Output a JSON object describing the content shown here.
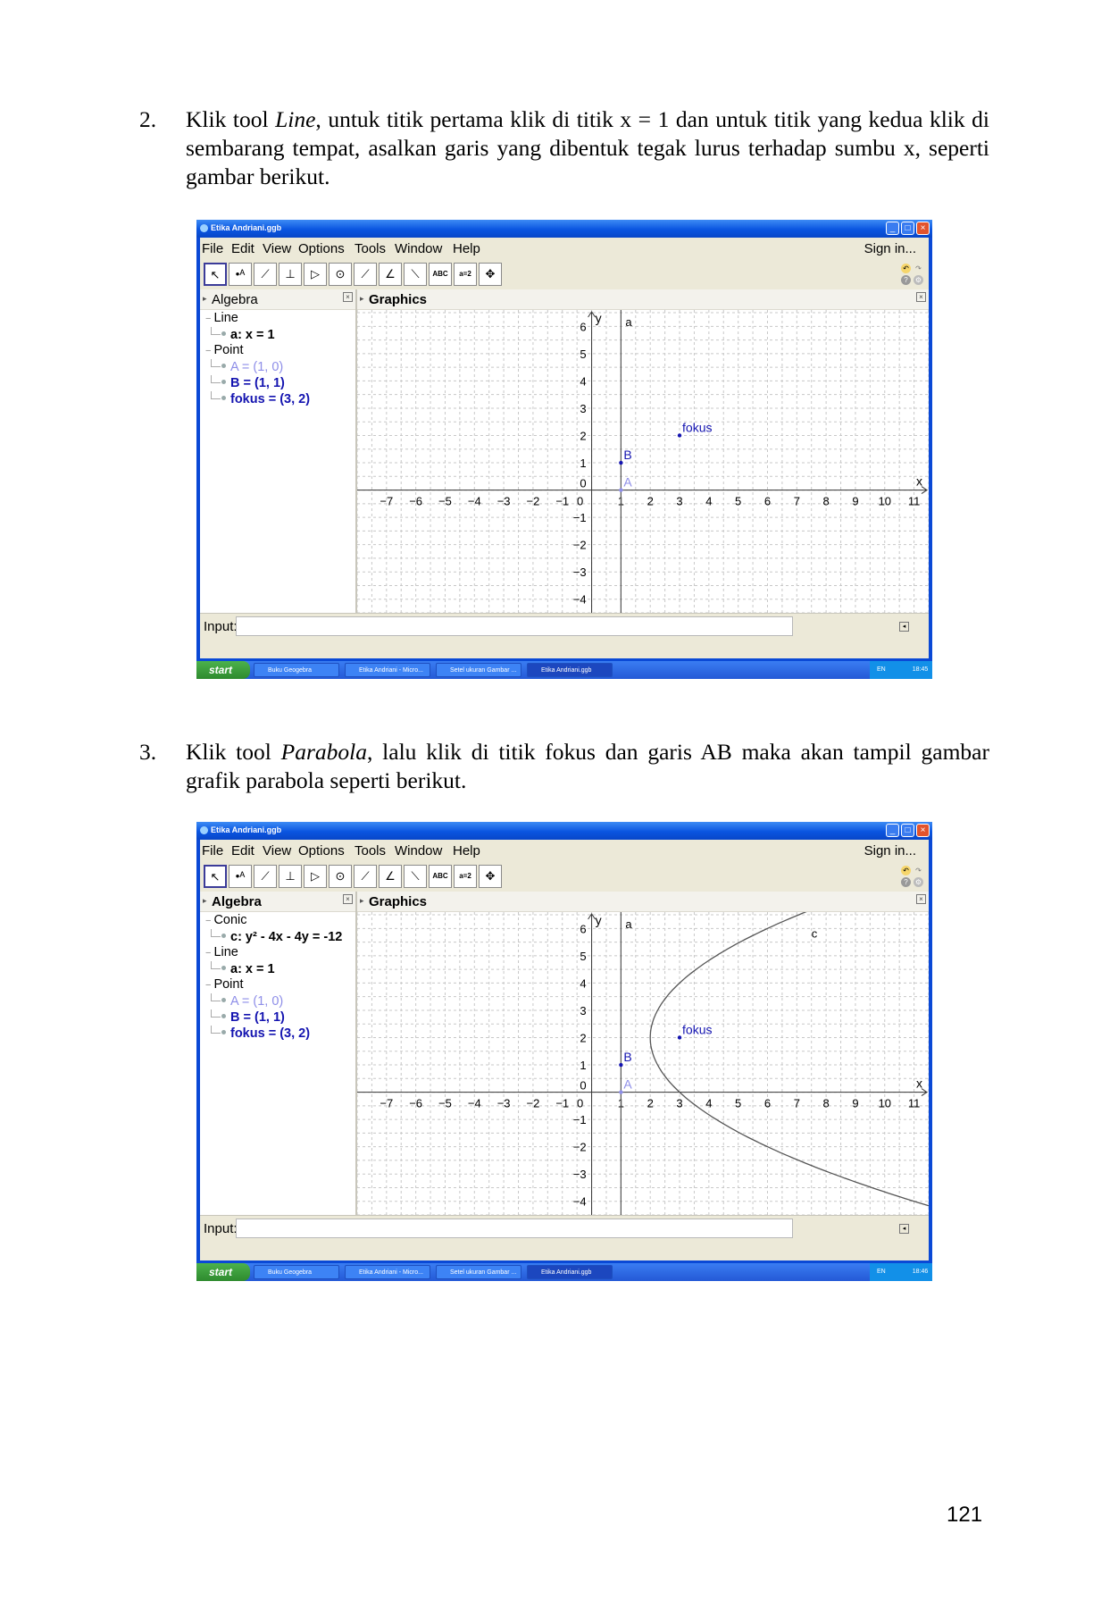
{
  "step2": {
    "number": "2.",
    "text_pre": "Klik tool ",
    "text_italic": "Line",
    "text_post": ", untuk titik pertama klik di titik x = 1 dan untuk titik yang kedua klik di sembarang tempat, asalkan garis yang dibentuk tegak lurus terhadap sumbu x, seperti gambar berikut."
  },
  "step3": {
    "number": "3.",
    "text_pre": "Klik tool ",
    "text_italic": "Parabola",
    "text_post": ", lalu klik di titik fokus dan garis AB maka akan tampil gambar grafik parabola seperti berikut."
  },
  "page_number": "121",
  "screens": [
    {
      "window_title": "Etika Andriani.ggb",
      "menu": [
        "File",
        "Edit",
        "View",
        "Options",
        "Tools",
        "Window",
        "Help"
      ],
      "sign_in": "Sign in...",
      "algebra_title": "Algebra",
      "graphics_title": "Graphics",
      "tree": [
        {
          "kind": "cat",
          "text": "Line"
        },
        {
          "kind": "item",
          "text": "a: x = 1",
          "style": "bold"
        },
        {
          "kind": "cat",
          "text": "Point"
        },
        {
          "kind": "item",
          "text": "A = (1, 0)",
          "style": "light"
        },
        {
          "kind": "item",
          "text": "B = (1, 1)",
          "style": "blue"
        },
        {
          "kind": "item",
          "text": "fokus = (3, 2)",
          "style": "blue"
        }
      ],
      "input_label": "Input:",
      "taskbar": {
        "start": "start",
        "items": [
          "Buku Geogebra",
          "Etika Andriani - Micro...",
          "Setel ukuran Gambar ...",
          "Etika Andriani.ggb"
        ],
        "lang": "EN",
        "time": "18:45"
      }
    },
    {
      "window_title": "Etika Andriani.ggb",
      "menu": [
        "File",
        "Edit",
        "View",
        "Options",
        "Tools",
        "Window",
        "Help"
      ],
      "sign_in": "Sign in...",
      "algebra_title": "Algebra",
      "graphics_title": "Graphics",
      "tree": [
        {
          "kind": "cat",
          "text": "Conic"
        },
        {
          "kind": "item",
          "text": "c: y² - 4x - 4y = -12",
          "style": "bold"
        },
        {
          "kind": "cat",
          "text": "Line"
        },
        {
          "kind": "item",
          "text": "a: x = 1",
          "style": "bold"
        },
        {
          "kind": "cat",
          "text": "Point"
        },
        {
          "kind": "item",
          "text": "A = (1, 0)",
          "style": "light"
        },
        {
          "kind": "item",
          "text": "B = (1, 1)",
          "style": "blue"
        },
        {
          "kind": "item",
          "text": "fokus = (3, 2)",
          "style": "blue"
        }
      ],
      "input_label": "Input:",
      "taskbar": {
        "start": "start",
        "items": [
          "Buku Geogebra",
          "Etika Andriani - Micro...",
          "Setel ukuran Gambar ...",
          "Etika Andriani.ggb"
        ],
        "lang": "EN",
        "time": "18:46"
      }
    }
  ],
  "chart_data": [
    {
      "type": "scatter",
      "xlim": [
        -8,
        11.5
      ],
      "ylim": [
        -4.5,
        6.6
      ],
      "x_ticks": [
        -7,
        -6,
        -5,
        -4,
        -3,
        -2,
        -1,
        0,
        1,
        2,
        3,
        4,
        5,
        6,
        7,
        8,
        9,
        10,
        11
      ],
      "y_ticks": [
        -4,
        -3,
        -2,
        -1,
        0,
        1,
        2,
        3,
        4,
        5,
        6
      ],
      "xlabel": "x",
      "ylabel": "y",
      "grid": true,
      "points": [
        {
          "name": "A",
          "x": 1,
          "y": 0,
          "color": "#8e8ee8"
        },
        {
          "name": "B",
          "x": 1,
          "y": 1,
          "color": "#1414b0"
        },
        {
          "name": "fokus",
          "x": 3,
          "y": 2,
          "color": "#1414b0"
        }
      ],
      "lines": [
        {
          "name": "a",
          "x": 1
        }
      ]
    },
    {
      "type": "scatter",
      "xlim": [
        -8,
        11.5
      ],
      "ylim": [
        -4.5,
        6.6
      ],
      "x_ticks": [
        -7,
        -6,
        -5,
        -4,
        -3,
        -2,
        -1,
        0,
        1,
        2,
        3,
        4,
        5,
        6,
        7,
        8,
        9,
        10,
        11
      ],
      "y_ticks": [
        -4,
        -3,
        -2,
        -1,
        0,
        1,
        2,
        3,
        4,
        5,
        6
      ],
      "xlabel": "x",
      "ylabel": "y",
      "grid": true,
      "points": [
        {
          "name": "A",
          "x": 1,
          "y": 0,
          "color": "#8e8ee8"
        },
        {
          "name": "B",
          "x": 1,
          "y": 1,
          "color": "#1414b0"
        },
        {
          "name": "fokus",
          "x": 3,
          "y": 2,
          "color": "#1414b0"
        }
      ],
      "lines": [
        {
          "name": "a",
          "x": 1
        }
      ],
      "conic": {
        "name": "c",
        "equation": "y² - 4x - 4y = -12",
        "vertex": [
          2,
          2
        ],
        "p": 1
      }
    }
  ]
}
